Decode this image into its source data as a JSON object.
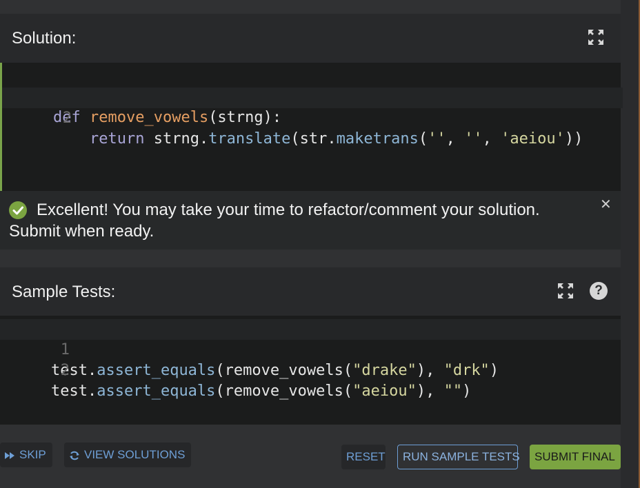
{
  "solution": {
    "title": "Solution:",
    "lines": [
      {
        "num": "1",
        "t1": "def",
        "t2": " ",
        "t3": "remove_vowels",
        "t4": "(strng):"
      },
      {
        "num": "2",
        "t1": "    ",
        "t2": "return",
        "t3": " strng.",
        "t4": "translate",
        "t5": "(str.",
        "t6": "maketrans",
        "t7": "(",
        "t8": "''",
        "t9": ", ",
        "t10": "''",
        "t11": ", ",
        "t12": "'aeiou'",
        "t13": "))"
      }
    ]
  },
  "alert": {
    "line1": "Excellent! You may take your time to refactor/comment your solution.",
    "line2": "Submit when ready.",
    "close": "✕"
  },
  "tests": {
    "title": "Sample Tests:",
    "help": "?",
    "lines": [
      {
        "num": "1",
        "a": "test.",
        "b": "assert_equals",
        "c": "(remove_vowels(",
        "d": "\"drake\"",
        "e": "), ",
        "f": "\"drk\"",
        "g": ")"
      },
      {
        "num": "2",
        "a": "test.",
        "b": "assert_equals",
        "c": "(remove_vowels(",
        "d": "\"aeiou\"",
        "e": "), ",
        "f": "\"\"",
        "g": ")"
      }
    ]
  },
  "buttons": {
    "skip": "SKIP",
    "view_solutions": "VIEW SOLUTIONS",
    "reset": "RESET",
    "run_tests": "RUN SAMPLE TESTS",
    "submit": "SUBMIT FINAL"
  },
  "icons": {
    "expand": "expand-icon",
    "check": "check-circle-icon",
    "close": "close-icon",
    "help": "help-icon",
    "skip": "fast-forward-icon",
    "view": "refresh-icon"
  },
  "colors": {
    "accent_green": "#7ba441",
    "link_blue": "#6e9fd6"
  }
}
